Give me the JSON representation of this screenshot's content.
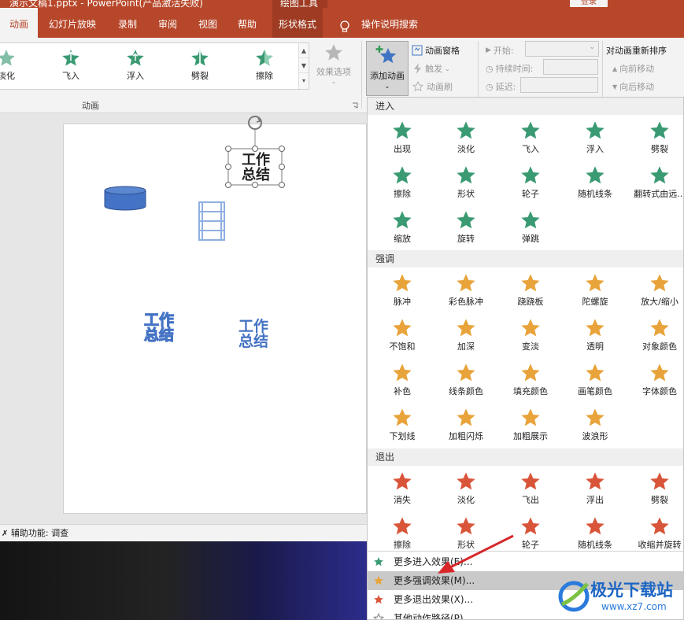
{
  "titlebar": {
    "title": "演示文稿1.pptx  -  PowerPoint(产品激活失败)",
    "context_title": "绘图工具",
    "login": "登录"
  },
  "tabs": {
    "animation": "动画",
    "slideshow": "幻灯片放映",
    "record": "录制",
    "review": "审阅",
    "view": "视图",
    "help": "帮助",
    "shape_format": "形状格式",
    "search": "操作说明搜索"
  },
  "ribbon": {
    "gallery": [
      "淡化",
      "飞入",
      "浮入",
      "劈裂",
      "擦除"
    ],
    "group_label": "动画",
    "effect_options": "效果选项",
    "add_animation": "添加动画",
    "anim_pane": "动画窗格",
    "trigger": "触发",
    "anim_painter": "动画刷",
    "start": "开始:",
    "duration": "持续时间:",
    "delay": "延迟:",
    "reorder": "对动画重新排序",
    "move_earlier": "向前移动",
    "move_later": "向后移动"
  },
  "slide": {
    "textbox1": "工作\n总结",
    "textbox2": "工作\n总结",
    "textbox3": "工作\n总结"
  },
  "status": {
    "accessibility": "辅助功能: 调查"
  },
  "dropdown": {
    "entrance_label": "进入",
    "entrance": [
      "出现",
      "淡化",
      "飞入",
      "浮入",
      "劈裂",
      "擦除",
      "形状",
      "轮子",
      "随机线条",
      "翻转式由远...",
      "缩放",
      "旋转",
      "弹跳"
    ],
    "emphasis_label": "强调",
    "emphasis": [
      "脉冲",
      "彩色脉冲",
      "跷跷板",
      "陀螺旋",
      "放大/缩小",
      "不饱和",
      "加深",
      "变淡",
      "透明",
      "对象颜色",
      "补色",
      "线条颜色",
      "填充颜色",
      "画笔颜色",
      "字体颜色",
      "下划线",
      "加粗闪烁",
      "加粗展示",
      "波浪形"
    ],
    "exit_label": "退出",
    "exit": [
      "消失",
      "淡化",
      "飞出",
      "浮出",
      "劈裂",
      "擦除",
      "形状",
      "轮子",
      "随机线条",
      "收缩并旋转"
    ],
    "more_entrance": "更多进入效果(E)...",
    "more_emphasis": "更多强调效果(M)...",
    "more_exit": "更多退出效果(X)...",
    "more_path": "其他动作路径(P)..."
  },
  "watermark": {
    "name": "极光下载站",
    "url": "www.xz7.com"
  },
  "colors": {
    "accent": "#b7472a",
    "entrance": "#3a9a72",
    "emphasis": "#e8a33a",
    "exit": "#d9553a"
  }
}
